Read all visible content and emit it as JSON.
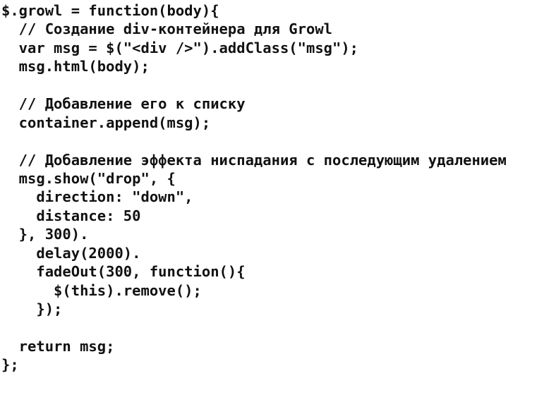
{
  "code": {
    "language": "javascript",
    "lines": [
      "$.growl = function(body){",
      "  // Создание div-контейнера для Growl",
      "  var msg = $(\"<div />\").addClass(\"msg\");",
      "  msg.html(body);",
      "",
      "  // Добавление его к списку",
      "  container.append(msg);",
      "",
      "  // Добавление эффекта ниспадания с последующим удалением",
      "  msg.show(\"drop\", {",
      "    direction: \"down\",",
      "    distance: 50",
      "  }, 300).",
      "    delay(2000).",
      "    fadeOut(300, function(){",
      "      $(this).remove();",
      "    });",
      "",
      "  return msg;",
      "};"
    ]
  }
}
